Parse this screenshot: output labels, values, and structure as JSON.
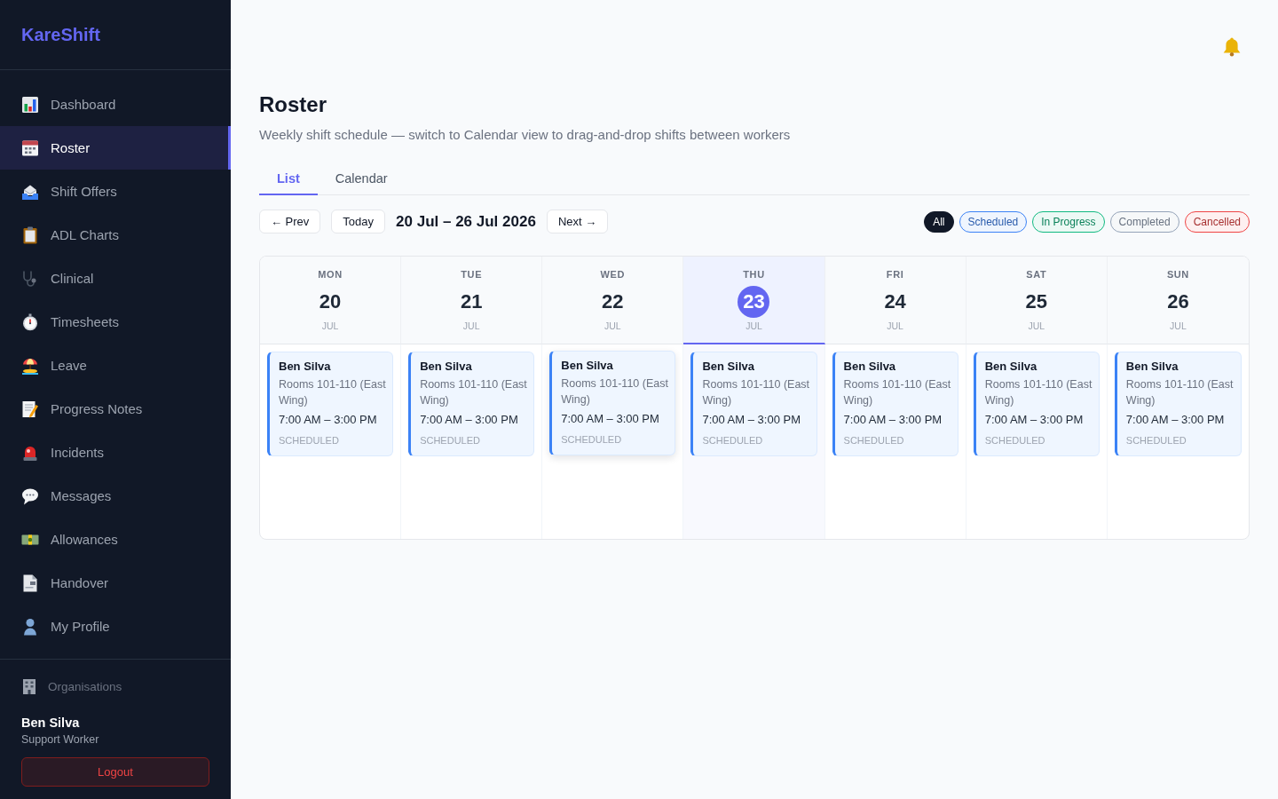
{
  "sidebar": {
    "logo": "KareShift",
    "nav": [
      {
        "label": "Dashboard",
        "selected": false
      },
      {
        "label": "Roster",
        "selected": true
      },
      {
        "label": "Shift Offers",
        "selected": false
      },
      {
        "label": "ADL Charts",
        "selected": false
      },
      {
        "label": "Clinical",
        "selected": false
      },
      {
        "label": "Timesheets",
        "selected": false
      },
      {
        "label": "Leave",
        "selected": false
      },
      {
        "label": "Progress Notes",
        "selected": false
      },
      {
        "label": "Incidents",
        "selected": false
      },
      {
        "label": "Messages",
        "selected": false
      },
      {
        "label": "Allowances",
        "selected": false
      },
      {
        "label": "Handover",
        "selected": false
      },
      {
        "label": "My Profile",
        "selected": false
      }
    ],
    "organisations_link": "Organisations",
    "user": {
      "name": "Ben Silva",
      "role": "Support Worker"
    },
    "logout_button": "Logout"
  },
  "page": {
    "title": "Roster",
    "subtitle": "Weekly shift schedule — switch to Calendar view to drag-and-drop shifts between workers"
  },
  "tabs": [
    {
      "label": "List",
      "selected": true
    },
    {
      "label": "Calendar",
      "selected": false
    }
  ],
  "toolbar": {
    "prev_button": "← Prev",
    "today_button": "Today",
    "date_range": "20 Jul – 26 Jul 2026",
    "next_button": "Next →"
  },
  "filters": [
    {
      "label": "All",
      "selected": true,
      "color": "#111827"
    },
    {
      "label": "Scheduled",
      "selected": false,
      "color": "#3b82f6"
    },
    {
      "label": "In Progress",
      "selected": false,
      "color": "#10b981"
    },
    {
      "label": "Completed",
      "selected": false,
      "color": "#94a3b8"
    },
    {
      "label": "Cancelled",
      "selected": false,
      "color": "#ef4444"
    }
  ],
  "calendar": {
    "days": [
      {
        "weekday": "MON",
        "date": "20",
        "month": "JUL",
        "today": false,
        "shifts": [
          {
            "worker": "Ben Silva",
            "location": "Rooms 101-110 (East Wing)",
            "time": "7:00 AM – 3:00 PM",
            "status": "SCHEDULED",
            "hovered": false
          }
        ]
      },
      {
        "weekday": "TUE",
        "date": "21",
        "month": "JUL",
        "today": false,
        "shifts": [
          {
            "worker": "Ben Silva",
            "location": "Rooms 101-110 (East Wing)",
            "time": "7:00 AM – 3:00 PM",
            "status": "SCHEDULED",
            "hovered": false
          }
        ]
      },
      {
        "weekday": "WED",
        "date": "22",
        "month": "JUL",
        "today": false,
        "shifts": [
          {
            "worker": "Ben Silva",
            "location": "Rooms 101-110 (East Wing)",
            "time": "7:00 AM – 3:00 PM",
            "status": "SCHEDULED",
            "hovered": true
          }
        ]
      },
      {
        "weekday": "THU",
        "date": "23",
        "month": "JUL",
        "today": true,
        "shifts": [
          {
            "worker": "Ben Silva",
            "location": "Rooms 101-110 (East Wing)",
            "time": "7:00 AM – 3:00 PM",
            "status": "SCHEDULED",
            "hovered": false
          }
        ]
      },
      {
        "weekday": "FRI",
        "date": "24",
        "month": "JUL",
        "today": false,
        "shifts": [
          {
            "worker": "Ben Silva",
            "location": "Rooms 101-110 (East Wing)",
            "time": "7:00 AM – 3:00 PM",
            "status": "SCHEDULED",
            "hovered": false
          }
        ]
      },
      {
        "weekday": "SAT",
        "date": "25",
        "month": "JUL",
        "today": false,
        "shifts": [
          {
            "worker": "Ben Silva",
            "location": "Rooms 101-110 (East Wing)",
            "time": "7:00 AM – 3:00 PM",
            "status": "SCHEDULED",
            "hovered": false
          }
        ]
      },
      {
        "weekday": "SUN",
        "date": "26",
        "month": "JUL",
        "today": false,
        "shifts": [
          {
            "worker": "Ben Silva",
            "location": "Rooms 101-110 (East Wing)",
            "time": "7:00 AM – 3:00 PM",
            "status": "SCHEDULED",
            "hovered": false
          }
        ]
      }
    ]
  }
}
